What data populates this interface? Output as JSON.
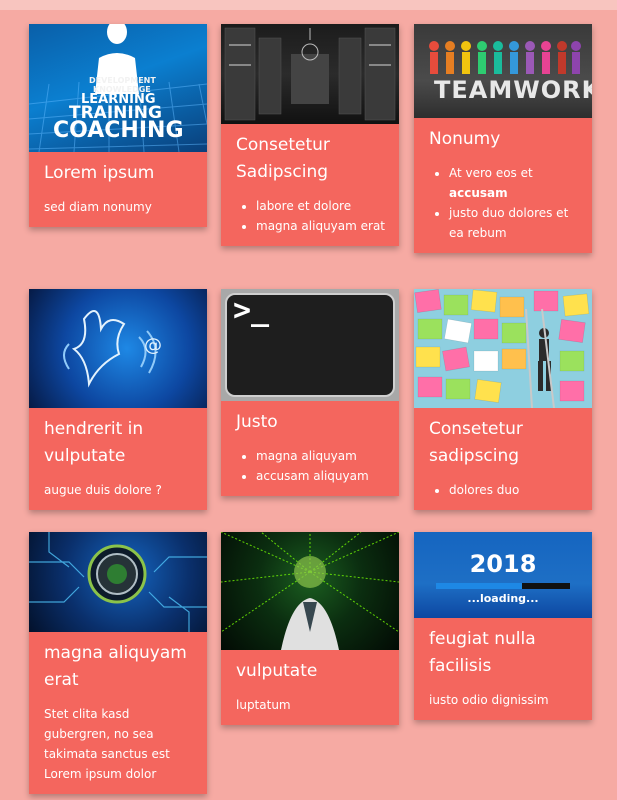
{
  "colors": {
    "page_bg": "#f6aaa3",
    "card_bg": "#f4665e",
    "text": "#ffffff"
  },
  "image_texts": {
    "coaching": [
      "DEVELOPMENT",
      "KNOWLEDGE",
      "LEARNING",
      "TRAINING",
      "COACHING"
    ],
    "teamwork": "TEAMWORK",
    "terminal": ">_",
    "mail": "@",
    "loading_year": "2018",
    "loading_label": "...loading..."
  },
  "cards": [
    {
      "title": "Lorem ipsum",
      "text": "sed diam nonumy"
    },
    {
      "title": "Consetetur Sadipscing",
      "items": [
        "labore et dolore",
        "magna aliquyam erat"
      ]
    },
    {
      "title": "Nonumy",
      "items": [
        "At vero eos et",
        "accusam",
        "justo duo dolores et ea rebum"
      ]
    },
    {
      "title": "hendrerit in vulputate",
      "text": "augue duis dolore ?"
    },
    {
      "title": "Justo",
      "items": [
        "magna aliquyam",
        "accusam aliquyam"
      ]
    },
    {
      "title": "Consetetur sadipscing",
      "items": [
        "dolores duo"
      ]
    },
    {
      "title": "magna aliquyam erat",
      "text": "Stet clita kasd gubergren, no sea takimata sanctus est Lorem ipsum dolor"
    },
    {
      "title": "vulputate",
      "text": "luptatum"
    },
    {
      "title": "feugiat nulla facilisis",
      "text": "iusto odio dignissim"
    }
  ]
}
